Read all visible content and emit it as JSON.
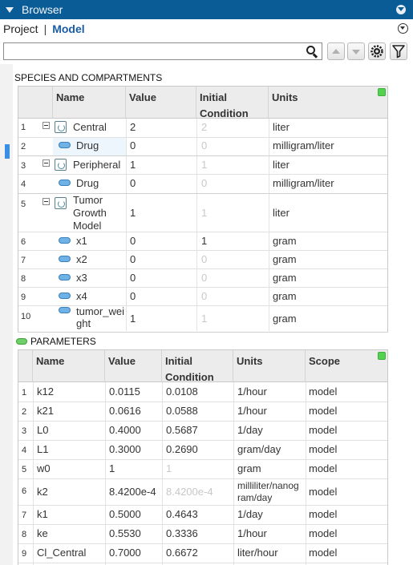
{
  "window": {
    "title": "Browser"
  },
  "tabs": {
    "project": "Project",
    "separator": "|",
    "model": "Model"
  },
  "search": {
    "value": "",
    "placeholder": ""
  },
  "species_section": {
    "title": "SPECIES AND COMPARTMENTS",
    "columns": [
      "Name",
      "Value",
      "Initial",
      "Condition",
      "Units"
    ],
    "rows": [
      {
        "num": "1",
        "name": "Central",
        "value": "2",
        "ic": "2",
        "units": "liter",
        "kind": "compartment"
      },
      {
        "num": "2",
        "name": "Drug",
        "value": "0",
        "ic": "0",
        "units": "milligram/liter",
        "kind": "species"
      },
      {
        "num": "3",
        "name": "Peripheral",
        "value": "1",
        "ic": "1",
        "units": "liter",
        "kind": "compartment"
      },
      {
        "num": "4",
        "name": "Drug",
        "value": "0",
        "ic": "0",
        "units": "milligram/liter",
        "kind": "species"
      },
      {
        "num": "5",
        "name_lines": [
          "Tumor",
          "Growth",
          "Model"
        ],
        "value": "1",
        "ic": "1",
        "units": "liter",
        "kind": "compartment"
      },
      {
        "num": "6",
        "name": "x1",
        "value": "0",
        "ic": "1",
        "units": "gram",
        "kind": "species"
      },
      {
        "num": "7",
        "name": "x2",
        "value": "0",
        "ic": "0",
        "units": "gram",
        "kind": "species"
      },
      {
        "num": "8",
        "name": "x3",
        "value": "0",
        "ic": "0",
        "units": "gram",
        "kind": "species"
      },
      {
        "num": "9",
        "name": "x4",
        "value": "0",
        "ic": "0",
        "units": "gram",
        "kind": "species"
      },
      {
        "num": "10",
        "name_lines": [
          "tumor_wei",
          "ght"
        ],
        "value": "1",
        "ic": "1",
        "units": "gram",
        "kind": "species"
      }
    ]
  },
  "parameters_section": {
    "title": "PARAMETERS",
    "columns": [
      "Name",
      "Value",
      "Initial",
      "Condition",
      "Units",
      "Scope"
    ],
    "rows": [
      {
        "num": "1",
        "name": "k12",
        "value": "0.0115",
        "ic": "0.0108",
        "units": "1/hour",
        "scope": "model"
      },
      {
        "num": "2",
        "name": "k21",
        "value": "0.0616",
        "ic": "0.0588",
        "units": "1/hour",
        "scope": "model"
      },
      {
        "num": "3",
        "name": "L0",
        "value": "0.4000",
        "ic": "0.5687",
        "units": "1/day",
        "scope": "model"
      },
      {
        "num": "4",
        "name": "L1",
        "value": "0.3000",
        "ic": "0.2690",
        "units": "gram/day",
        "scope": "model"
      },
      {
        "num": "5",
        "name": "w0",
        "value": "1",
        "ic": "1",
        "units": "gram",
        "scope": "model"
      },
      {
        "num": "6",
        "name": "k2",
        "value": "8.4200e-4",
        "ic": "8.4200e-4",
        "units_lines": [
          "milliliter/nanog",
          "ram/day"
        ],
        "scope": "model"
      },
      {
        "num": "7",
        "name": "k1",
        "value": "0.5000",
        "ic": "0.4643",
        "units": "1/day",
        "scope": "model"
      },
      {
        "num": "8",
        "name": "ke",
        "value": "0.5530",
        "ic": "0.3336",
        "units": "1/hour",
        "scope": "model"
      },
      {
        "num": "9",
        "name": "Cl_Central",
        "value": "0.7000",
        "ic": "0.6672",
        "units": "liter/hour",
        "scope": "model"
      }
    ]
  },
  "colors": {
    "titlebar": "#0a5c96",
    "accent_tab": "#1a5da6",
    "status_green": "#53d24f",
    "species_blue": "#6fb2e6",
    "parameter_green": "#6fd06a"
  },
  "icons": [
    "collapse-triangle-icon",
    "panel-menu-icon",
    "search-icon",
    "move-up-icon",
    "move-down-icon",
    "settings-icon",
    "filter-icon",
    "compartment-icon",
    "species-icon",
    "parameter-icon",
    "collapse-minus-icon"
  ]
}
